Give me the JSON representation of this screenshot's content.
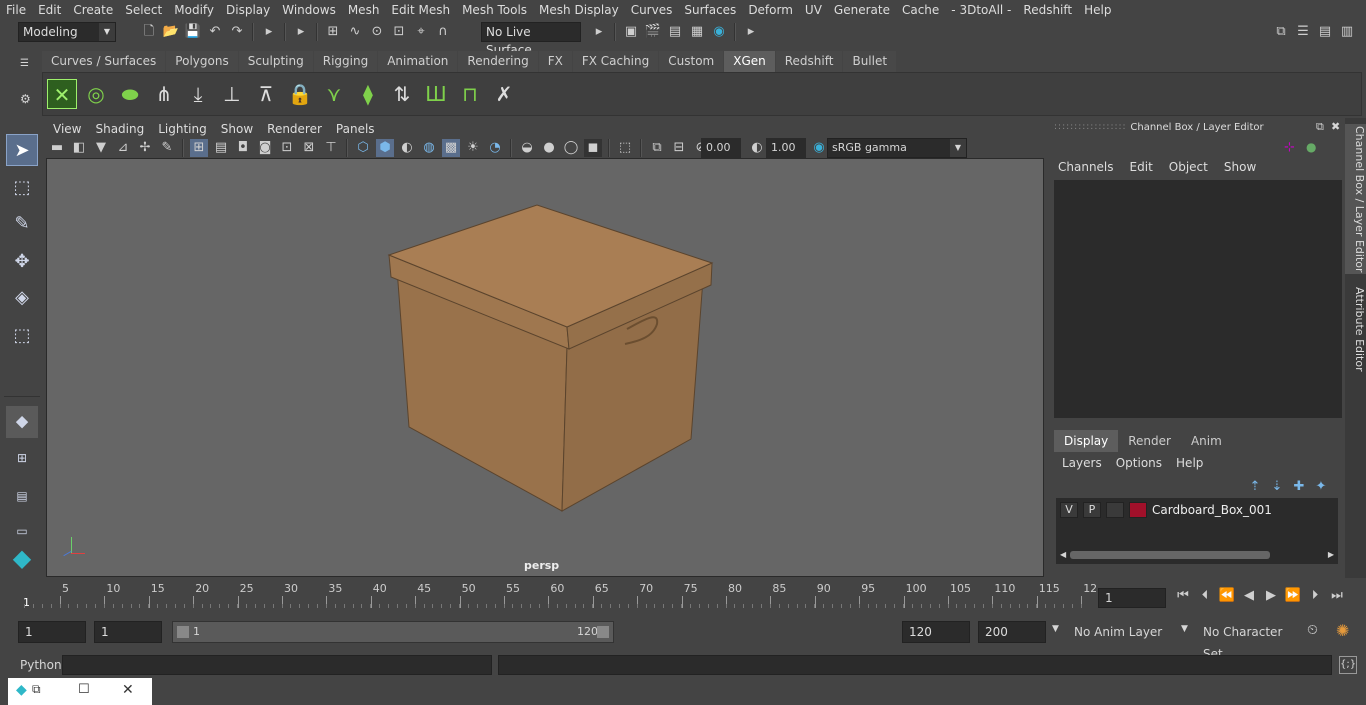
{
  "menu": {
    "items": [
      "File",
      "Edit",
      "Create",
      "Select",
      "Modify",
      "Display",
      "Windows",
      "Mesh",
      "Edit Mesh",
      "Mesh Tools",
      "Mesh Display",
      "Curves",
      "Surfaces",
      "Deform",
      "UV",
      "Generate",
      "Cache",
      "- 3DtoAll -",
      "Redshift",
      "Help"
    ]
  },
  "status": {
    "mode": "Modeling",
    "live_surface": "No Live Surface"
  },
  "shelf": {
    "tabs": [
      "Curves / Surfaces",
      "Polygons",
      "Sculpting",
      "Rigging",
      "Animation",
      "Rendering",
      "FX",
      "FX Caching",
      "Custom",
      "XGen",
      "Redshift",
      "Bullet"
    ],
    "active_tab": "XGen"
  },
  "viewport": {
    "menu": [
      "View",
      "Shading",
      "Lighting",
      "Show",
      "Renderer",
      "Panels"
    ],
    "exposure": "0.00",
    "gamma": "1.00",
    "color_space": "sRGB gamma",
    "camera_label": "persp",
    "box_color": "#a67c52"
  },
  "channel_box": {
    "title": "Channel Box / Layer Editor",
    "menu": [
      "Channels",
      "Edit",
      "Object",
      "Show"
    ]
  },
  "layer_editor": {
    "tabs": [
      "Display",
      "Render",
      "Anim"
    ],
    "active_tab": "Display",
    "menu": [
      "Layers",
      "Options",
      "Help"
    ],
    "layer": {
      "v": "V",
      "p": "P",
      "name": "Cardboard_Box_001",
      "color": "#a0102a"
    }
  },
  "side_tabs": [
    "Channel Box / Layer Editor",
    "Attribute Editor"
  ],
  "timeline": {
    "ticks": [
      "5",
      "10",
      "15",
      "20",
      "25",
      "30",
      "35",
      "40",
      "45",
      "50",
      "55",
      "60",
      "65",
      "70",
      "75",
      "80",
      "85",
      "90",
      "95",
      "100",
      "105",
      "110",
      "115",
      "12"
    ],
    "start_marker": "1",
    "current_frame": "1"
  },
  "range": {
    "start": "1",
    "playback_start": "1",
    "bar_start": "1",
    "bar_end": "120",
    "playback_end": "120",
    "end": "200",
    "anim_layer": "No Anim Layer",
    "character_set": "No Character Set"
  },
  "command": {
    "label": "Python"
  }
}
